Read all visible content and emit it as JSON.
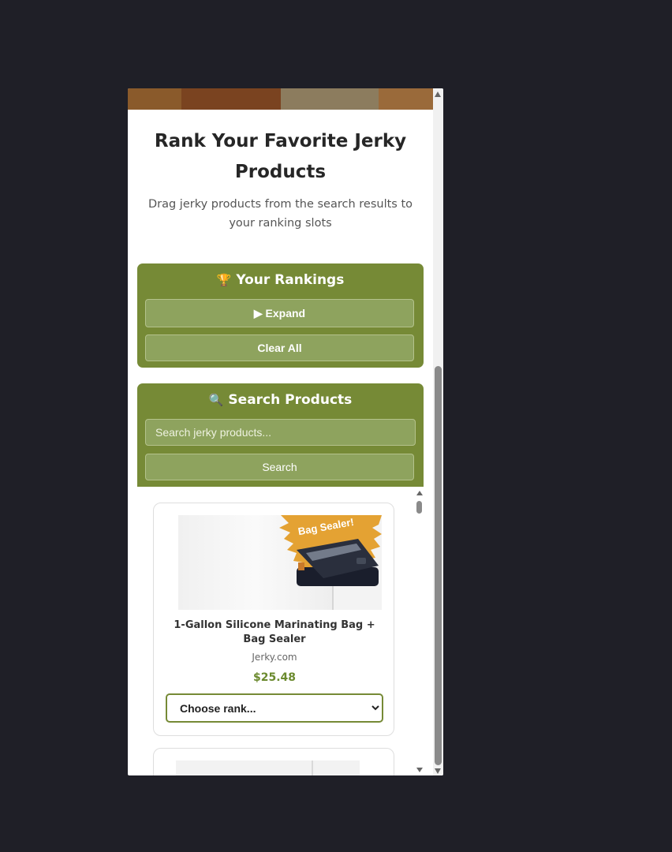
{
  "header": {
    "title": "Rank Your Favorite Jerky Products",
    "subtitle": "Drag jerky products from the search results to your ranking slots",
    "banner_colors": [
      "#8a5a2b",
      "#7a4320",
      "#8c7c5e",
      "#9a6a3a"
    ]
  },
  "rankings": {
    "emoji": "🏆",
    "title": "Your Rankings",
    "expand_label": "▶ Expand",
    "clear_label": "Clear All"
  },
  "search": {
    "emoji": "🔍",
    "title": "Search Products",
    "placeholder": "Search jerky products...",
    "button_label": "Search"
  },
  "results": [
    {
      "name": "1-Gallon Silicone Marinating Bag + Bag Sealer",
      "brand": "Jerky.com",
      "price": "$25.48",
      "image_badge": "Bag Sealer!",
      "rank_select": "Choose rank..."
    }
  ],
  "colors": {
    "panel_green": "#768a36",
    "button_green": "#8ea35e",
    "price_green": "#6b8a2e",
    "page_bg": "#1f1f27"
  }
}
